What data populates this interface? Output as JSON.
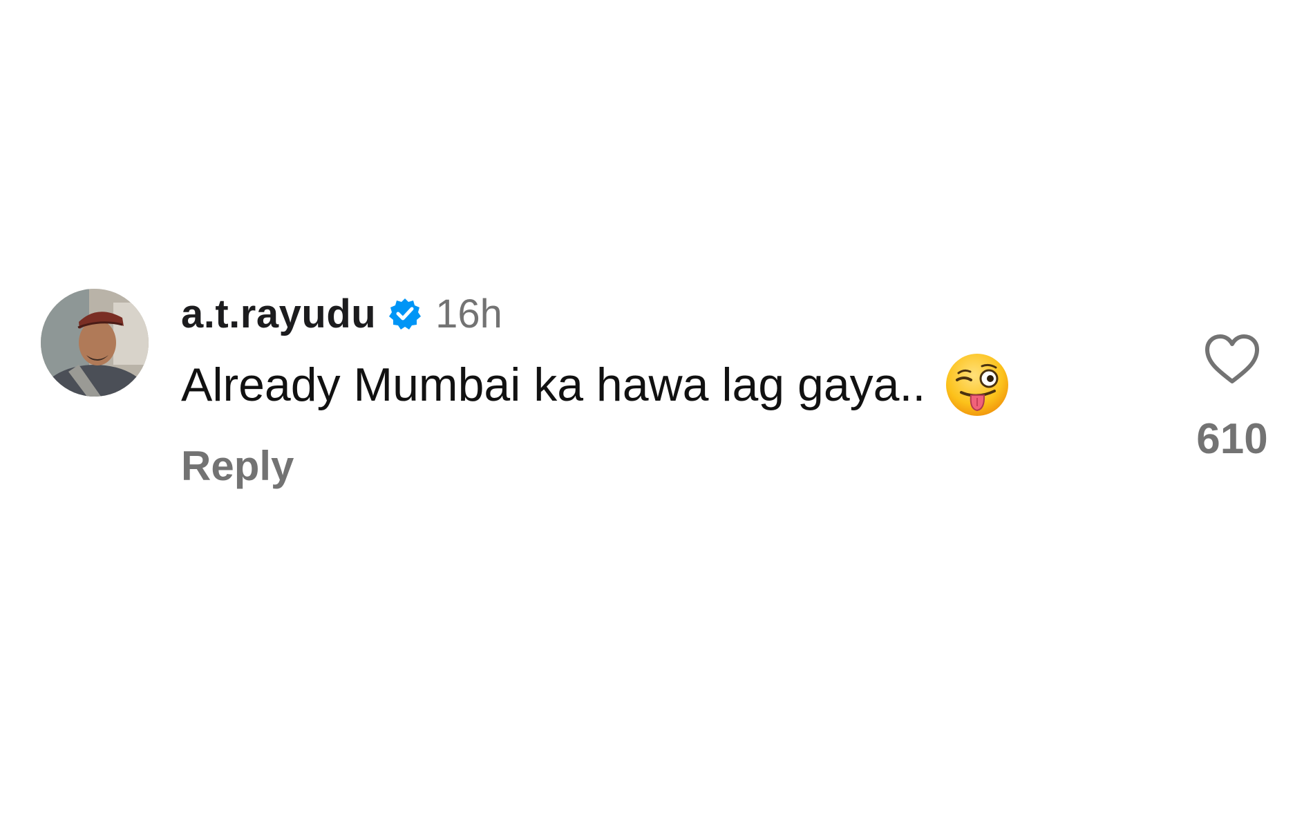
{
  "comment": {
    "username": "a.t.rayudu",
    "verified": true,
    "timestamp": "16h",
    "text": "Already Mumbai ka hawa lag gaya..",
    "emoji_icon": "winking-face-with-tongue-icon",
    "reply_label": "Reply",
    "like_icon": "heart-outline-icon",
    "like_count": "610"
  },
  "colors": {
    "verified_badge": "#0095f6",
    "secondary_text": "#737373",
    "primary_text": "#111111"
  }
}
